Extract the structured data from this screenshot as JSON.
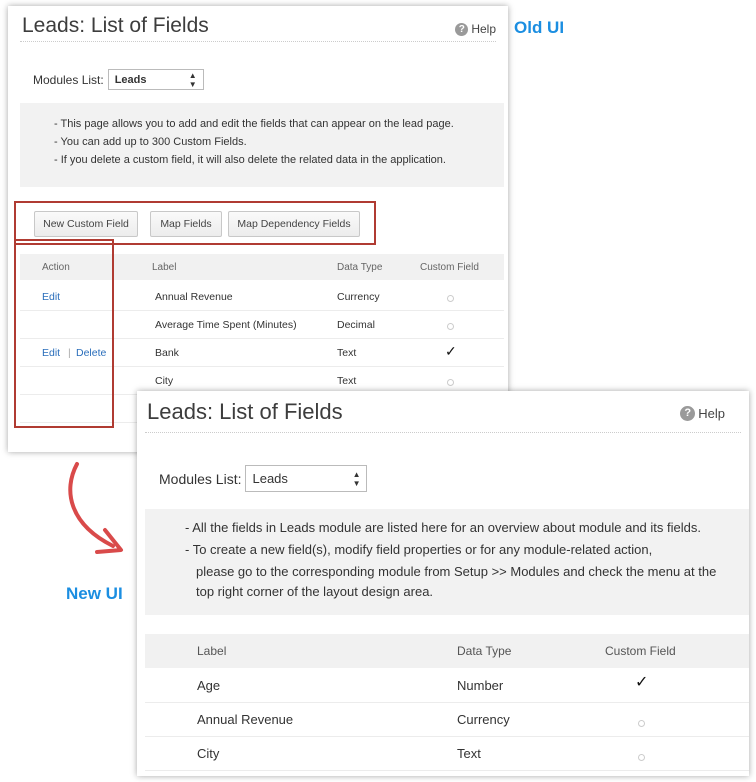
{
  "labels": {
    "old_ui": "Old UI",
    "new_ui": "New UI"
  },
  "old": {
    "title": "Leads: List of Fields",
    "help": "Help",
    "modules_label": "Modules List:",
    "modules_value": "Leads",
    "info": [
      "- This page allows you to add and edit the fields that can appear on the lead page.",
      "- You can add up to 300 Custom Fields.",
      "- If you delete a custom field, it will also delete the related data in the application."
    ],
    "buttons": {
      "new_custom_field": "New Custom Field",
      "map_fields": "Map Fields",
      "map_dependency": "Map Dependency Fields"
    },
    "headers": {
      "action": "Action",
      "label": "Label",
      "data_type": "Data Type",
      "custom_field": "Custom Field"
    },
    "rows": [
      {
        "edit": "Edit",
        "delete": "",
        "label": "Annual Revenue",
        "type": "Currency",
        "custom": false
      },
      {
        "edit": "",
        "delete": "",
        "label": "Average Time Spent (Minutes)",
        "type": "Decimal",
        "custom": false
      },
      {
        "edit": "Edit",
        "delete": "Delete",
        "label": "Bank",
        "type": "Text",
        "custom": true
      },
      {
        "edit": "",
        "delete": "",
        "label": "City",
        "type": "Text",
        "custom": false
      }
    ]
  },
  "new": {
    "title": "Leads: List of Fields",
    "help": "Help",
    "modules_label": "Modules List:",
    "modules_value": "Leads",
    "info": [
      "-   All the fields in Leads module are listed here for an overview about module and its fields.",
      "-   To create a new field(s), modify field properties or for any module-related action,",
      "please go to the corresponding module from Setup >> Modules and check the menu at the",
      "top right corner of the layout design area."
    ],
    "headers": {
      "label": "Label",
      "data_type": "Data Type",
      "custom_field": "Custom Field"
    },
    "rows": [
      {
        "label": "Age",
        "type": "Number",
        "custom": true
      },
      {
        "label": "Annual Revenue",
        "type": "Currency",
        "custom": false
      },
      {
        "label": "City",
        "type": "Text",
        "custom": false
      }
    ]
  },
  "check_glyph": "✓"
}
